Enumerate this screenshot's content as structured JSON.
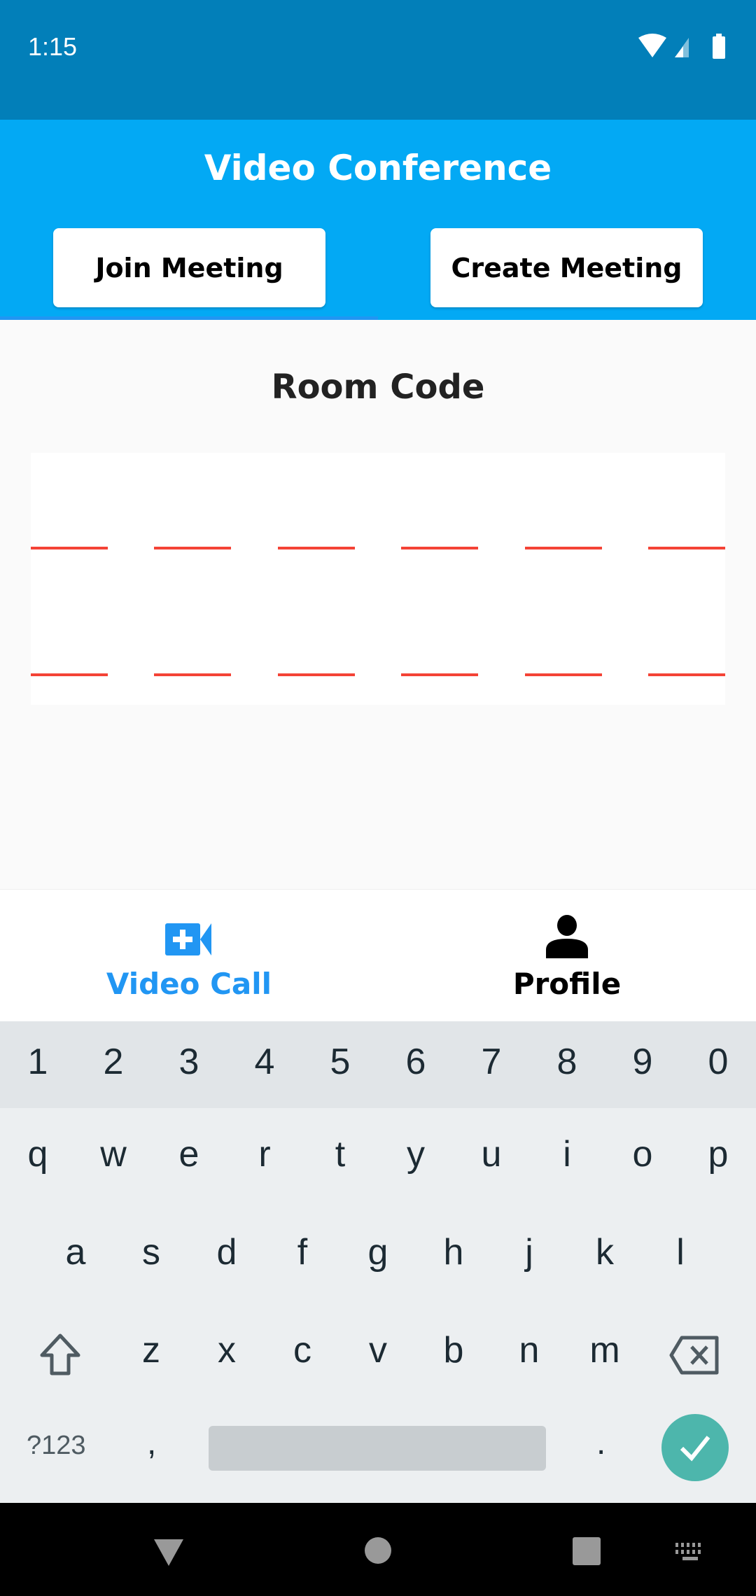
{
  "status": {
    "time": "1:15",
    "icons": [
      "wifi-icon",
      "signal-icon",
      "battery-icon"
    ]
  },
  "header": {
    "title": "Video Conference",
    "join_label": "Join Meeting",
    "create_label": "Create Meeting"
  },
  "main": {
    "room_code_title": "Room Code",
    "code_slots": 12
  },
  "bottom_nav": {
    "items": [
      {
        "label": "Video Call",
        "icon": "video-call-add-icon",
        "active": true
      },
      {
        "label": "Profile",
        "icon": "person-icon",
        "active": false
      }
    ]
  },
  "keyboard": {
    "numbers": [
      "1",
      "2",
      "3",
      "4",
      "5",
      "6",
      "7",
      "8",
      "9",
      "0"
    ],
    "row1": [
      "q",
      "w",
      "e",
      "r",
      "t",
      "y",
      "u",
      "i",
      "o",
      "p"
    ],
    "row2": [
      "a",
      "s",
      "d",
      "f",
      "g",
      "h",
      "j",
      "k",
      "l"
    ],
    "row3": [
      "z",
      "x",
      "c",
      "v",
      "b",
      "n",
      "m"
    ],
    "symbols_label": "?123",
    "comma": ",",
    "period": "."
  },
  "colors": {
    "status_bar": "#027fb9",
    "header": "#03a9f4",
    "accent": "#2196f3",
    "code_line": "#f44336",
    "enter": "#4db6ac"
  }
}
